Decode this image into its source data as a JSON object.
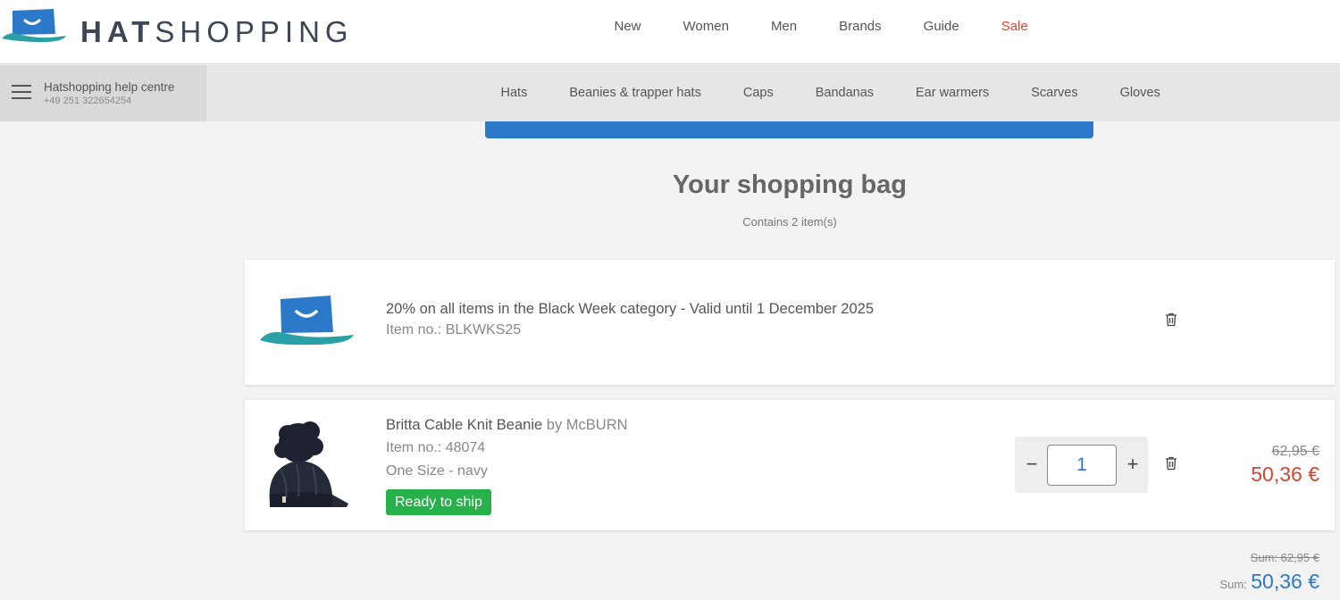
{
  "header": {
    "logo_bold": "HAT",
    "logo_light": "SHOPPING",
    "nav": [
      {
        "label": "New"
      },
      {
        "label": "Women"
      },
      {
        "label": "Men"
      },
      {
        "label": "Brands"
      },
      {
        "label": "Guide"
      },
      {
        "label": "Sale"
      }
    ],
    "sale_color": "#d6462f"
  },
  "help": {
    "title": "Hatshopping help centre",
    "phone": "+49 251 322654254"
  },
  "categories": [
    {
      "label": "Hats"
    },
    {
      "label": "Beanies & trapper hats"
    },
    {
      "label": "Caps"
    },
    {
      "label": "Bandanas"
    },
    {
      "label": "Ear warmers"
    },
    {
      "label": "Scarves"
    },
    {
      "label": "Gloves"
    }
  ],
  "bag": {
    "title": "Your shopping bag",
    "subtitle": "Contains 2 item(s)"
  },
  "voucher": {
    "description": "20% on all items in the Black Week category - Valid until 1 December 2025",
    "item_no": "Item no.: BLKWKS25",
    "icon": "hat-logo-icon"
  },
  "product": {
    "name": "Britta Cable Knit Beanie",
    "by": "by McBURN",
    "item_no": "Item no.: 48074",
    "variant": "One Size - navy",
    "badge": "Ready to ship",
    "quantity": "1",
    "minus": "−",
    "plus": "+",
    "old_price": "62,95 €",
    "new_price": "50,36 €",
    "icon": "beanie-image"
  },
  "summary": {
    "old_sum": "Sum: 62,95 €",
    "label": "Sum:",
    "value": "50,36 €"
  },
  "colors": {
    "accent_blue": "#2c79c9",
    "price_red": "#d6462f",
    "ship_green": "#27b14a"
  }
}
